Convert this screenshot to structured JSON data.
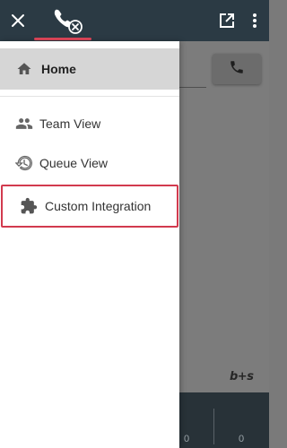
{
  "topbar": {
    "close_icon": "close-icon",
    "phone_icon": "phone-cancel-icon",
    "popout_icon": "open-in-new-icon",
    "more_icon": "more-vertical-icon",
    "accent_color": "#e0465a"
  },
  "drawer": {
    "items": [
      {
        "label": "Home",
        "icon": "home-icon",
        "selected": true
      },
      {
        "label": "Team View",
        "icon": "people-icon"
      },
      {
        "label": "Queue View",
        "icon": "history-icon"
      },
      {
        "label": "Custom Integration",
        "icon": "puzzle-icon",
        "highlighted": true
      }
    ]
  },
  "background": {
    "call_button_icon": "phone-icon",
    "logo_text": "b+s",
    "counters": [
      "0",
      "0"
    ]
  }
}
